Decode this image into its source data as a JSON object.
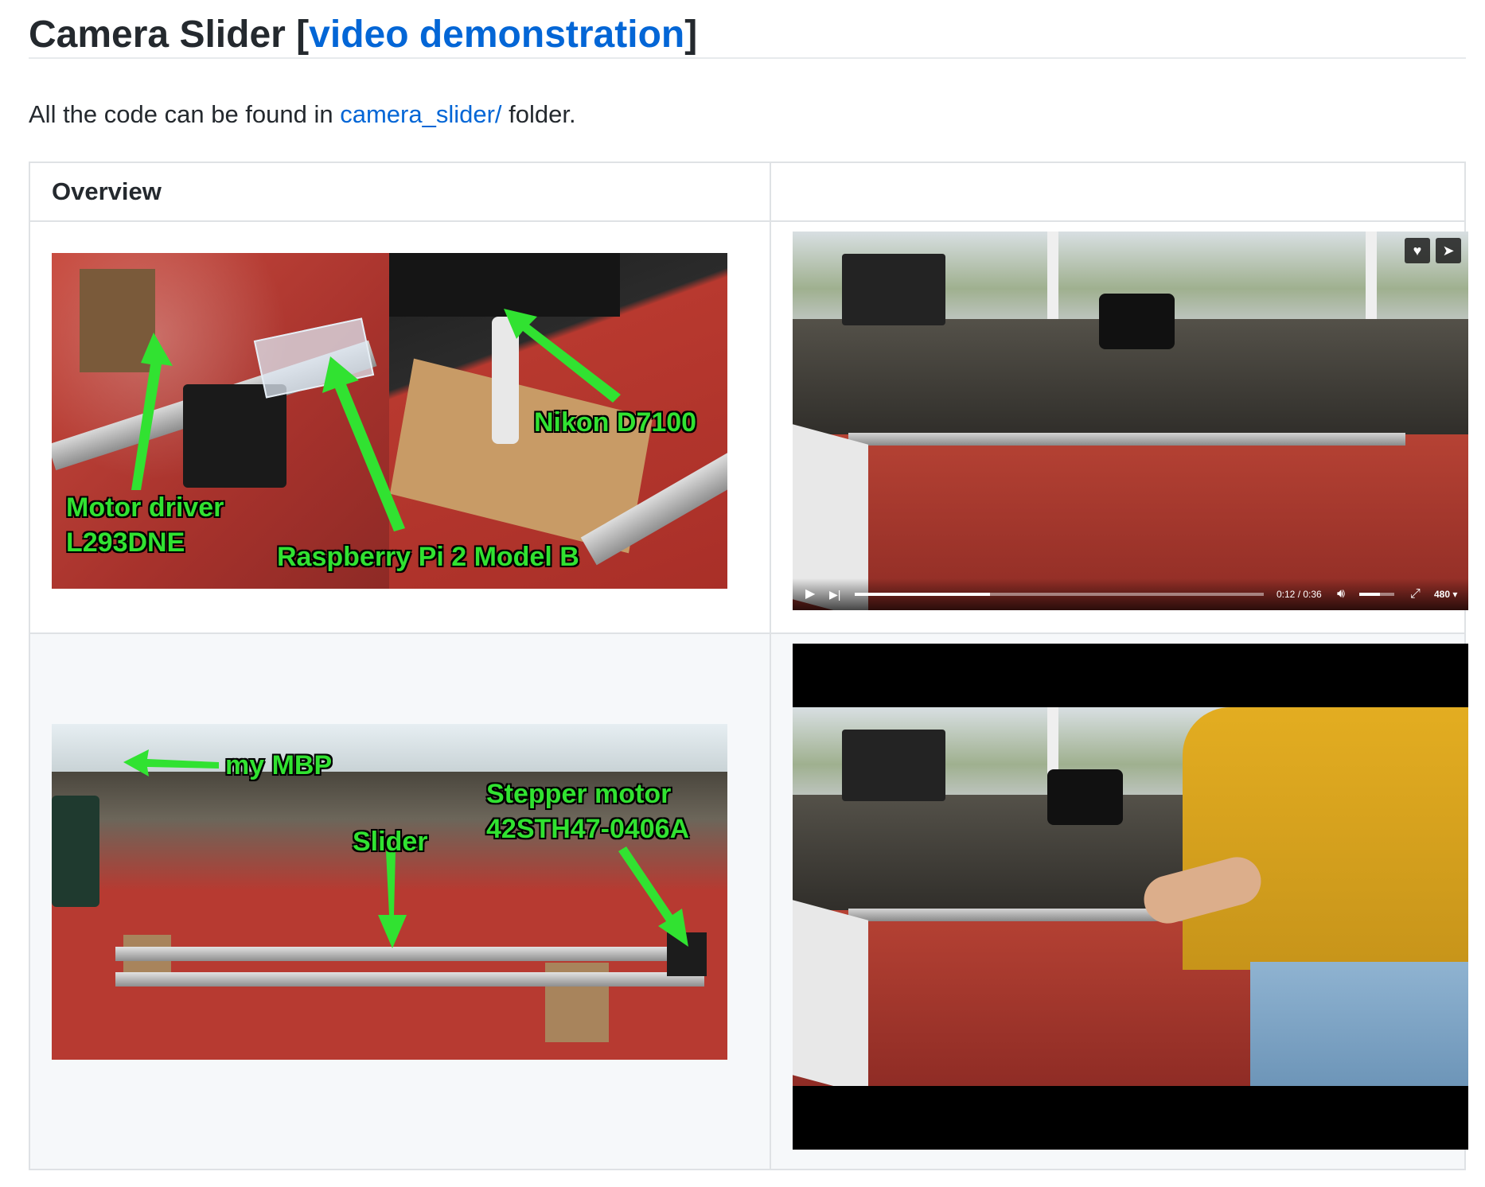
{
  "header": {
    "title_prefix": "Camera Slider [",
    "title_link": "video demonstration",
    "title_suffix": "]"
  },
  "intro": {
    "before": "All the code can be found in ",
    "link": "camera_slider/",
    "after": " folder."
  },
  "table": {
    "headers": [
      "Overview",
      ""
    ],
    "image1_labels": {
      "motor_driver_line1": "Motor driver",
      "motor_driver_line2": "L293DNE",
      "raspberry": "Raspberry Pi 2 Model B",
      "nikon": "Nikon D7100"
    },
    "image2_labels": {
      "mbp": "my MBP",
      "slider": "Slider",
      "stepper_line1": "Stepper motor",
      "stepper_line2": "42STH47-0406A"
    },
    "video_player": {
      "time": "0:12 / 0:36",
      "quality": "480",
      "progress_fraction": 0.33
    }
  },
  "icons": [
    "heart-icon",
    "share-icon",
    "play-icon",
    "skip-next-icon",
    "volume-icon",
    "fullscreen-icon",
    "chevron-down-icon"
  ]
}
